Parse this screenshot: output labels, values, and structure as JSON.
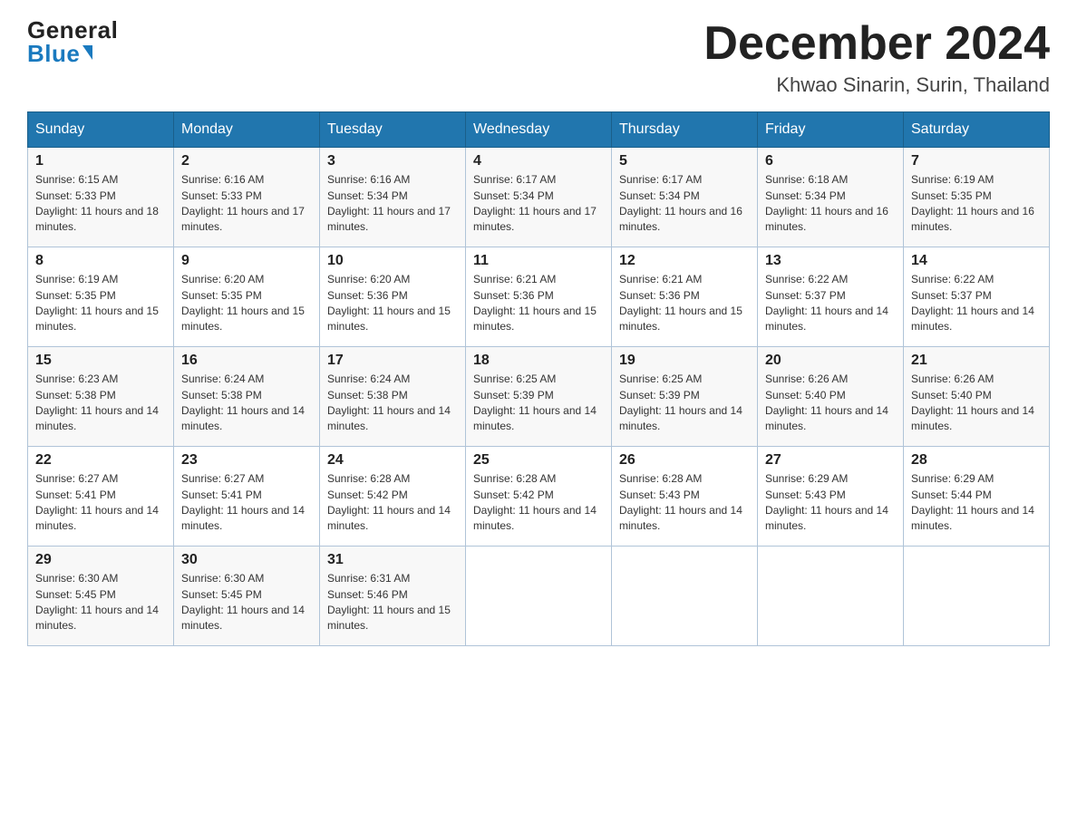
{
  "header": {
    "logo_general": "General",
    "logo_blue": "Blue",
    "month_title": "December 2024",
    "location": "Khwao Sinarin, Surin, Thailand"
  },
  "days_of_week": [
    "Sunday",
    "Monday",
    "Tuesday",
    "Wednesday",
    "Thursday",
    "Friday",
    "Saturday"
  ],
  "weeks": [
    [
      {
        "day": "1",
        "sunrise": "6:15 AM",
        "sunset": "5:33 PM",
        "daylight": "11 hours and 18 minutes."
      },
      {
        "day": "2",
        "sunrise": "6:16 AM",
        "sunset": "5:33 PM",
        "daylight": "11 hours and 17 minutes."
      },
      {
        "day": "3",
        "sunrise": "6:16 AM",
        "sunset": "5:34 PM",
        "daylight": "11 hours and 17 minutes."
      },
      {
        "day": "4",
        "sunrise": "6:17 AM",
        "sunset": "5:34 PM",
        "daylight": "11 hours and 17 minutes."
      },
      {
        "day": "5",
        "sunrise": "6:17 AM",
        "sunset": "5:34 PM",
        "daylight": "11 hours and 16 minutes."
      },
      {
        "day": "6",
        "sunrise": "6:18 AM",
        "sunset": "5:34 PM",
        "daylight": "11 hours and 16 minutes."
      },
      {
        "day": "7",
        "sunrise": "6:19 AM",
        "sunset": "5:35 PM",
        "daylight": "11 hours and 16 minutes."
      }
    ],
    [
      {
        "day": "8",
        "sunrise": "6:19 AM",
        "sunset": "5:35 PM",
        "daylight": "11 hours and 15 minutes."
      },
      {
        "day": "9",
        "sunrise": "6:20 AM",
        "sunset": "5:35 PM",
        "daylight": "11 hours and 15 minutes."
      },
      {
        "day": "10",
        "sunrise": "6:20 AM",
        "sunset": "5:36 PM",
        "daylight": "11 hours and 15 minutes."
      },
      {
        "day": "11",
        "sunrise": "6:21 AM",
        "sunset": "5:36 PM",
        "daylight": "11 hours and 15 minutes."
      },
      {
        "day": "12",
        "sunrise": "6:21 AM",
        "sunset": "5:36 PM",
        "daylight": "11 hours and 15 minutes."
      },
      {
        "day": "13",
        "sunrise": "6:22 AM",
        "sunset": "5:37 PM",
        "daylight": "11 hours and 14 minutes."
      },
      {
        "day": "14",
        "sunrise": "6:22 AM",
        "sunset": "5:37 PM",
        "daylight": "11 hours and 14 minutes."
      }
    ],
    [
      {
        "day": "15",
        "sunrise": "6:23 AM",
        "sunset": "5:38 PM",
        "daylight": "11 hours and 14 minutes."
      },
      {
        "day": "16",
        "sunrise": "6:24 AM",
        "sunset": "5:38 PM",
        "daylight": "11 hours and 14 minutes."
      },
      {
        "day": "17",
        "sunrise": "6:24 AM",
        "sunset": "5:38 PM",
        "daylight": "11 hours and 14 minutes."
      },
      {
        "day": "18",
        "sunrise": "6:25 AM",
        "sunset": "5:39 PM",
        "daylight": "11 hours and 14 minutes."
      },
      {
        "day": "19",
        "sunrise": "6:25 AM",
        "sunset": "5:39 PM",
        "daylight": "11 hours and 14 minutes."
      },
      {
        "day": "20",
        "sunrise": "6:26 AM",
        "sunset": "5:40 PM",
        "daylight": "11 hours and 14 minutes."
      },
      {
        "day": "21",
        "sunrise": "6:26 AM",
        "sunset": "5:40 PM",
        "daylight": "11 hours and 14 minutes."
      }
    ],
    [
      {
        "day": "22",
        "sunrise": "6:27 AM",
        "sunset": "5:41 PM",
        "daylight": "11 hours and 14 minutes."
      },
      {
        "day": "23",
        "sunrise": "6:27 AM",
        "sunset": "5:41 PM",
        "daylight": "11 hours and 14 minutes."
      },
      {
        "day": "24",
        "sunrise": "6:28 AM",
        "sunset": "5:42 PM",
        "daylight": "11 hours and 14 minutes."
      },
      {
        "day": "25",
        "sunrise": "6:28 AM",
        "sunset": "5:42 PM",
        "daylight": "11 hours and 14 minutes."
      },
      {
        "day": "26",
        "sunrise": "6:28 AM",
        "sunset": "5:43 PM",
        "daylight": "11 hours and 14 minutes."
      },
      {
        "day": "27",
        "sunrise": "6:29 AM",
        "sunset": "5:43 PM",
        "daylight": "11 hours and 14 minutes."
      },
      {
        "day": "28",
        "sunrise": "6:29 AM",
        "sunset": "5:44 PM",
        "daylight": "11 hours and 14 minutes."
      }
    ],
    [
      {
        "day": "29",
        "sunrise": "6:30 AM",
        "sunset": "5:45 PM",
        "daylight": "11 hours and 14 minutes."
      },
      {
        "day": "30",
        "sunrise": "6:30 AM",
        "sunset": "5:45 PM",
        "daylight": "11 hours and 14 minutes."
      },
      {
        "day": "31",
        "sunrise": "6:31 AM",
        "sunset": "5:46 PM",
        "daylight": "11 hours and 15 minutes."
      },
      null,
      null,
      null,
      null
    ]
  ]
}
